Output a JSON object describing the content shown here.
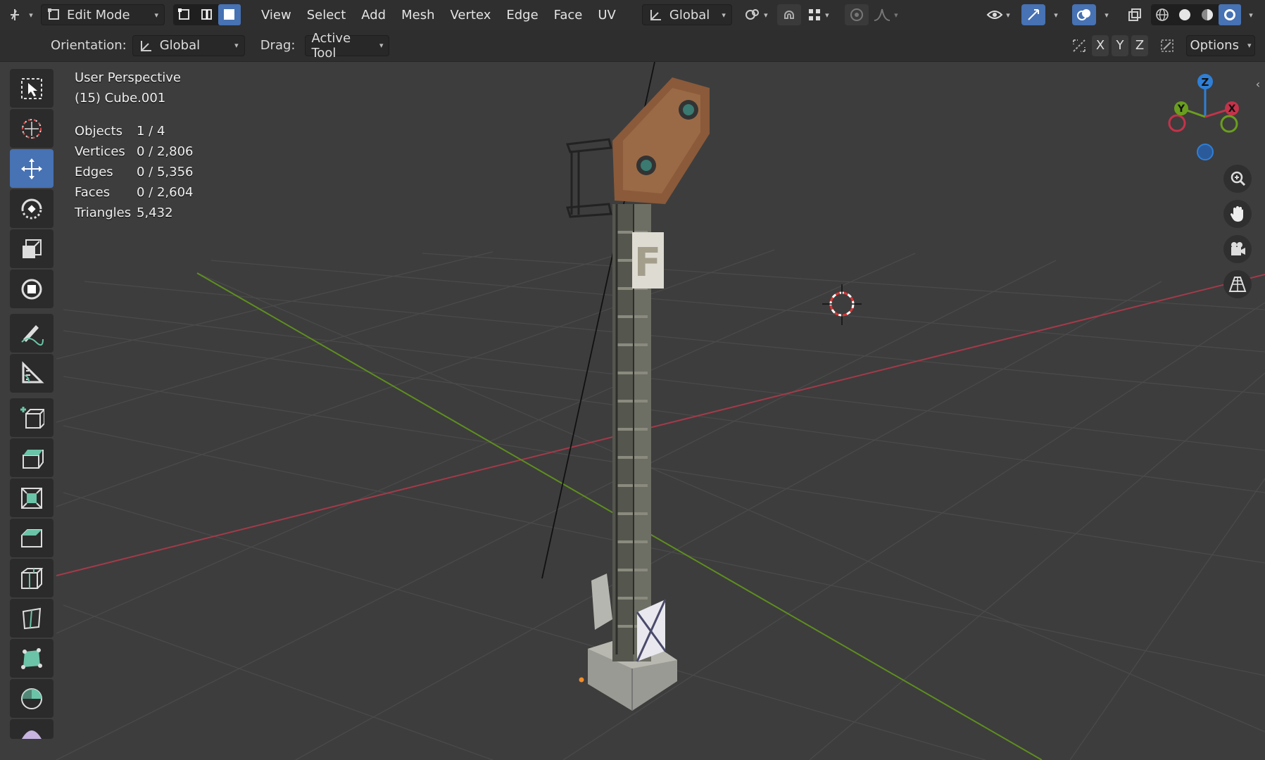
{
  "header": {
    "mode": "Edit Mode",
    "menus": [
      "View",
      "Select",
      "Add",
      "Mesh",
      "Vertex",
      "Edge",
      "Face",
      "UV"
    ],
    "transform_orientation": "Global"
  },
  "subheader": {
    "orientation_label": "Orientation:",
    "orientation_value": "Global",
    "drag_label": "Drag:",
    "drag_value": "Active Tool",
    "axes": [
      "X",
      "Y",
      "Z"
    ],
    "options_label": "Options"
  },
  "overlay": {
    "view_name": "User Perspective",
    "object_name": "(15) Cube.001",
    "stats": [
      {
        "label": "Objects",
        "value": "1 / 4"
      },
      {
        "label": "Vertices",
        "value": "0 / 2,806"
      },
      {
        "label": "Edges",
        "value": "0 / 5,356"
      },
      {
        "label": "Faces",
        "value": "0 / 2,604"
      },
      {
        "label": "Triangles",
        "value": "5,432"
      }
    ]
  },
  "gizmo": {
    "z": "Z",
    "y": "Y",
    "x": "X"
  },
  "sign_letter": "F",
  "colors": {
    "accent": "#4772b3",
    "x_axis": "#c4334a",
    "y_axis": "#6a9e1e",
    "z_axis": "#2f7fd6"
  }
}
